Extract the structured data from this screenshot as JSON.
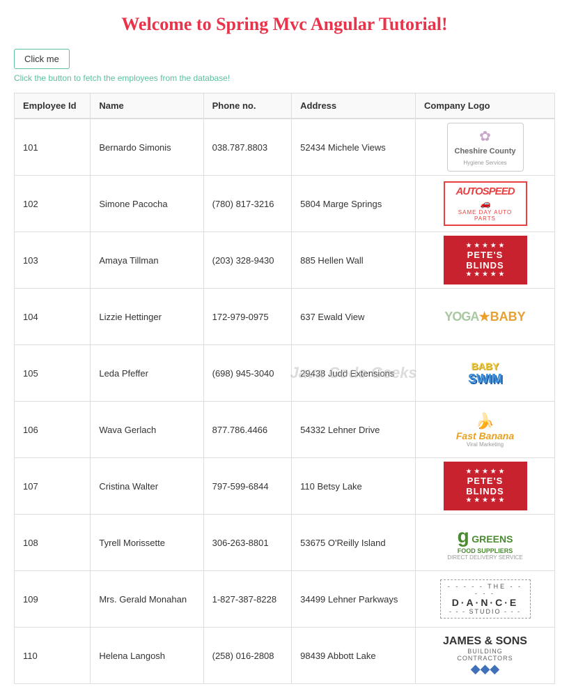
{
  "page": {
    "title": "Welcome to Spring Mvc Angular Tutorial!",
    "button_label": "Click me",
    "hint": "Click the button to fetch the employees from the database!"
  },
  "table": {
    "columns": [
      "Employee Id",
      "Name",
      "Phone no.",
      "Address",
      "Company Logo"
    ],
    "rows": [
      {
        "id": "101",
        "name": "Bernardo Simonis",
        "phone": "038.787.8803",
        "address": "52434 Michele Views",
        "logo": "cheshire"
      },
      {
        "id": "102",
        "name": "Simone Pacocha",
        "phone": "(780) 817-3216",
        "address": "5804 Marge Springs",
        "logo": "autospeed"
      },
      {
        "id": "103",
        "name": "Amaya Tillman",
        "phone": "(203) 328-9430",
        "address": "885 Hellen Wall",
        "logo": "petes"
      },
      {
        "id": "104",
        "name": "Lizzie Hettinger",
        "phone": "172-979-0975",
        "address": "637 Ewald View",
        "logo": "yogababy"
      },
      {
        "id": "105",
        "name": "Leda Pfeffer",
        "phone": "(698) 945-3040",
        "address": "29438 Judd Extensions",
        "logo": "babyswim"
      },
      {
        "id": "106",
        "name": "Wava Gerlach",
        "phone": "877.786.4466",
        "address": "54332 Lehner Drive",
        "logo": "fastbanana"
      },
      {
        "id": "107",
        "name": "Cristina Walter",
        "phone": "797-599-6844",
        "address": "110 Betsy Lake",
        "logo": "petes2"
      },
      {
        "id": "108",
        "name": "Tyrell Morissette",
        "phone": "306-263-8801",
        "address": "53675 O'Reilly Island",
        "logo": "greens"
      },
      {
        "id": "109",
        "name": "Mrs. Gerald Monahan",
        "phone": "1-827-387-8228",
        "address": "34499 Lehner Parkways",
        "logo": "dance"
      },
      {
        "id": "110",
        "name": "Helena Langosh",
        "phone": "(258) 016-2808",
        "address": "98439 Abbott Lake",
        "logo": "james"
      }
    ]
  }
}
